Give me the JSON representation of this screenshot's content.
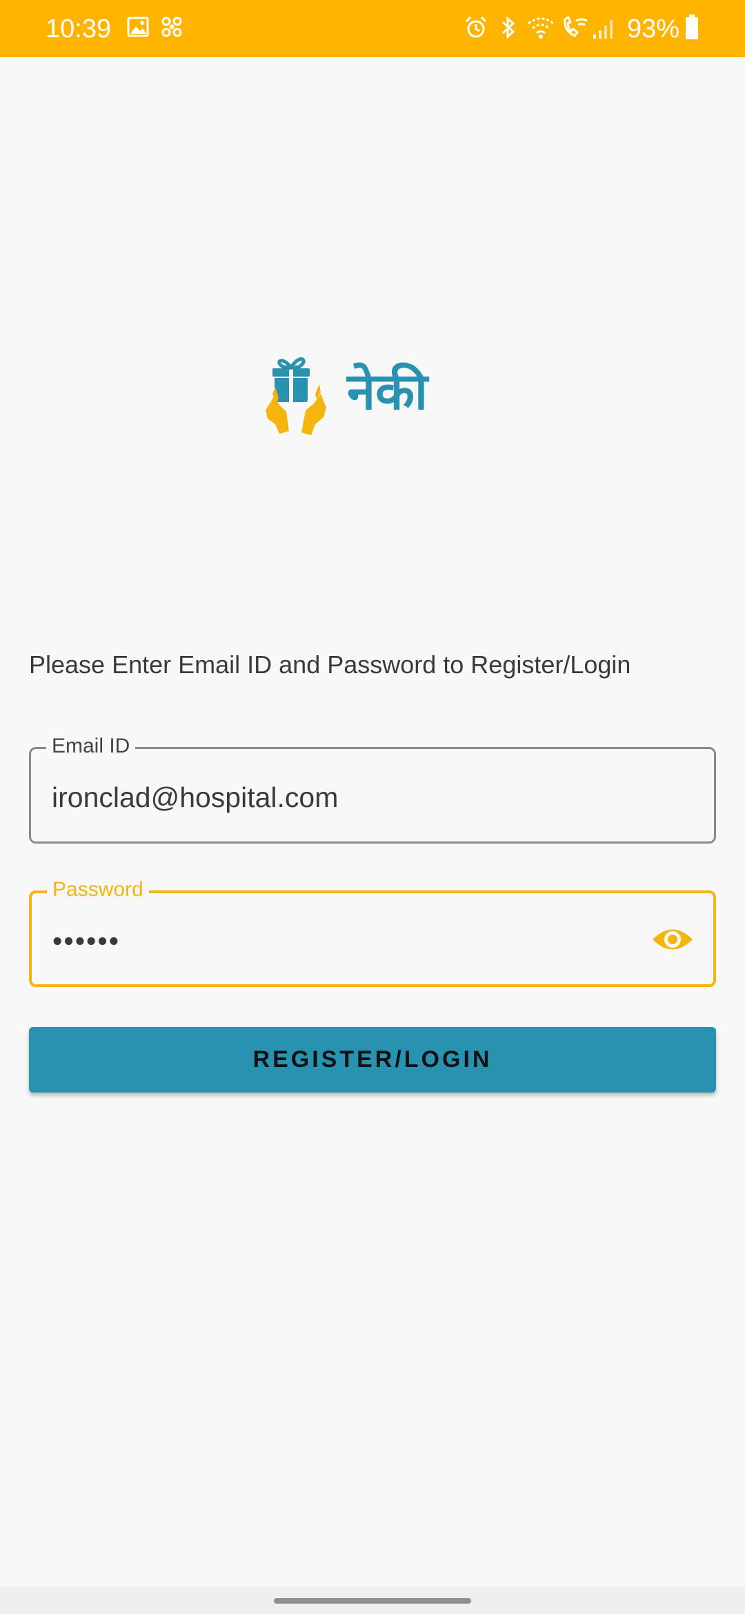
{
  "status_bar": {
    "time": "10:39",
    "battery": "93%",
    "icons": [
      "image-icon",
      "fan-icon",
      "alarm-icon",
      "bluetooth-icon",
      "wifi-icon",
      "wifi-calling-icon",
      "signal-icon",
      "battery-icon"
    ],
    "background_color": "#ffb400"
  },
  "logo": {
    "icon": "gift-hands-icon",
    "text": "नेकी",
    "brand_color": "#2992b0",
    "accent_color": "#f5b50f"
  },
  "instruction": "Please Enter Email ID and Password to Register/Login",
  "email_field": {
    "label": "Email ID",
    "value": "ironclad@hospital.com"
  },
  "password_field": {
    "label": "Password",
    "value": "••••••",
    "toggle_icon": "eye-icon",
    "focused": true
  },
  "primary_button": {
    "label": "REGISTER/LOGIN",
    "color": "#2893b1"
  }
}
